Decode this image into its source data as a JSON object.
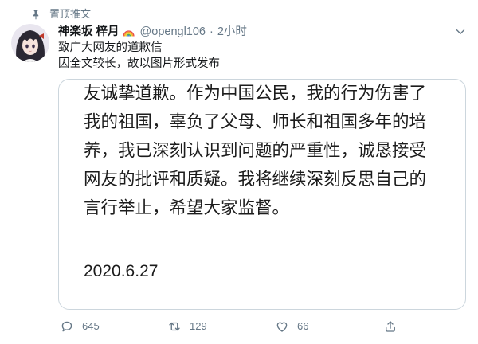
{
  "pinned": {
    "label": "置顶推文"
  },
  "author": {
    "display_name": "神楽坂 梓月",
    "handle": "@opengl106",
    "separator": "·",
    "time": "2小时"
  },
  "tweet": {
    "lines": [
      "致广大网友的道歉信",
      "因全文较长，故以图片形式发布"
    ]
  },
  "attached_image": {
    "lines": [
      "友诚挚道歉。作为中国公民，我的行为伤害了",
      "我的祖国，辜负了父母、师长和祖国多年的培",
      "养，我已深刻认识到问题的严重性，诚恳接受",
      "网友的批评和质疑。我将继续深刻反思自己的",
      "言行举止，希望大家监督。"
    ],
    "date": "2020.6.27"
  },
  "actions": {
    "reply": {
      "count": "645"
    },
    "retweet": {
      "count": "129"
    },
    "like": {
      "count": "66"
    }
  },
  "icons": {
    "pinned": "pin-icon",
    "avatar": "anime-girl-avatar",
    "name_emoji": "rainbow-emoji-icon",
    "menu": "chevron-down-icon",
    "reply": "reply-icon",
    "retweet": "retweet-icon",
    "like": "heart-icon",
    "share": "share-icon"
  },
  "colors": {
    "text_primary": "#14171a",
    "text_secondary": "#657786",
    "border": "#ccd6dd",
    "background": "#ffffff"
  }
}
